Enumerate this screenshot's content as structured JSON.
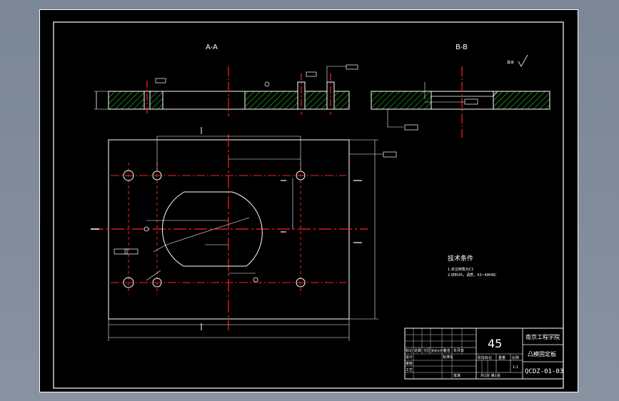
{
  "sections": {
    "aa_label": "A-A",
    "bb_label": "B-B"
  },
  "roughness_note": "其余",
  "tech_requirements": {
    "title": "技术条件",
    "lines": [
      "1.未注倒角为C1",
      "2.材料45，调质，43~48HRC"
    ]
  },
  "title_block": {
    "material": "45",
    "school": "南京工程学院",
    "part_name": "凸模固定板",
    "drawing_number": "QCDZ-01-03",
    "scale": "1:1",
    "sheet_info": "共1张  第1张",
    "labels": {
      "mark": "标记",
      "count": "处数",
      "zone": "分区",
      "change_doc": "更改文件号",
      "signature": "签名",
      "date": "年月日",
      "design": "设计",
      "standardize": "标准化",
      "check": "审核",
      "process": "工艺",
      "approve": "批准",
      "stage_mark": "阶段标记",
      "weight": "重量",
      "scale_label": "比例"
    }
  },
  "colors": {
    "background": "#000000",
    "line": "#ffffff",
    "centerline": "#ff2020",
    "hatch": "#22cc22"
  }
}
